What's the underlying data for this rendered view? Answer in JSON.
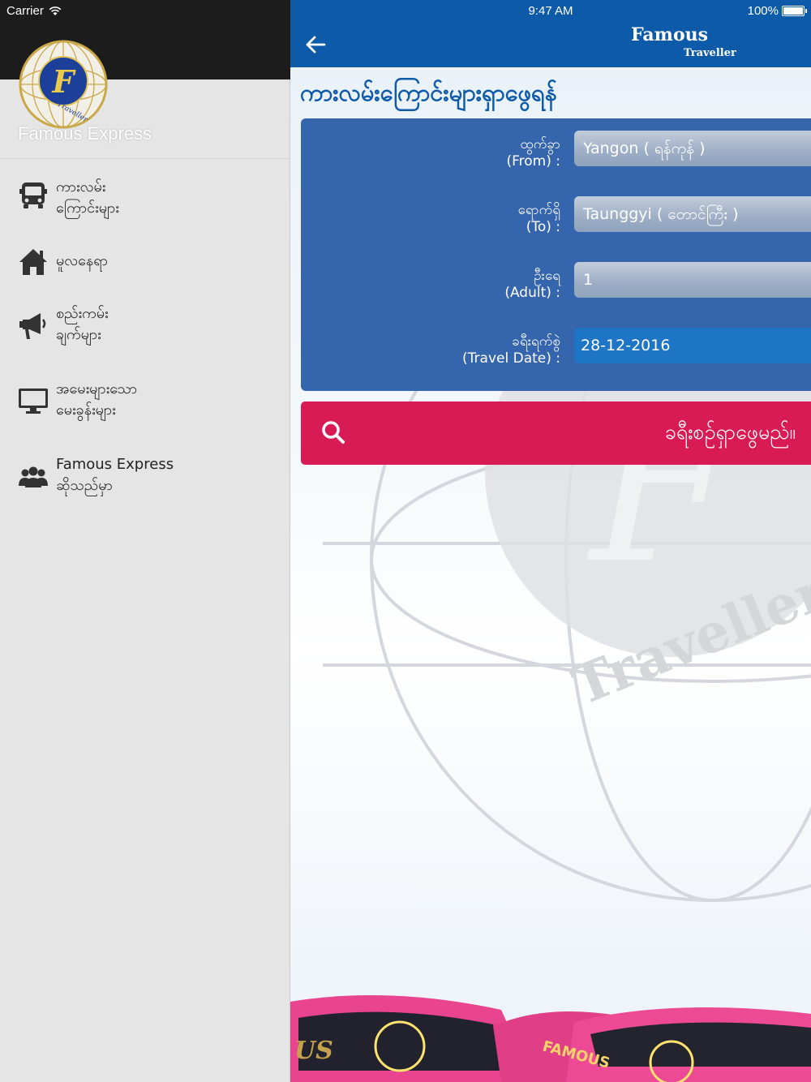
{
  "status_bar": {
    "carrier": "Carrier",
    "time": "9:47 AM",
    "battery": "100%"
  },
  "sidebar": {
    "brand": "Famous Express",
    "logo_text": {
      "letter": "F",
      "word": "Traveller"
    },
    "items": [
      {
        "label": "ကားလမ်း\nကြောင်းများ",
        "icon": "bus-icon"
      },
      {
        "label": "မူလနေရာ",
        "icon": "home-icon"
      },
      {
        "label": "စည်းကမ်း\nချက်များ",
        "icon": "megaphone-icon"
      },
      {
        "label": "အမေးများသော\nမေးခွန်းများ",
        "icon": "monitor-icon"
      },
      {
        "label": "Famous Express\nဆိုသည်မှာ",
        "icon": "people-icon"
      }
    ]
  },
  "navbar": {
    "logo_main": "Famous",
    "logo_sub": "Traveller"
  },
  "main": {
    "heading": "ကားလမ်းကြောင်းများရှာဖွေရန်",
    "form": {
      "from": {
        "label": "ထွက်ခွာ\n(From) :",
        "value": "Yangon ( ရန်ကုန် )"
      },
      "to": {
        "label": "ရောက်ရှိ\n(To) :",
        "value": "Taunggyi ( တောင်ကြီး )"
      },
      "adult": {
        "label": "ဦးရေ\n(Adult) :",
        "value": "1"
      },
      "date": {
        "label": "ခရီးရက်စွဲ\n(Travel Date) :",
        "value": "28-12-2016"
      }
    },
    "search_button": "ခရီးစဉ်ရှာဖွေမည်။",
    "watermark_text": "Traveller",
    "bus_text": [
      "US",
      "FAMOUS"
    ]
  },
  "colors": {
    "navbar": "#0d5aa8",
    "form_panel": "#3565ad",
    "search_button": "#d81b55",
    "sidebar_bg": "#e5e5e5",
    "sidebar_header": "#1c1c1c"
  }
}
